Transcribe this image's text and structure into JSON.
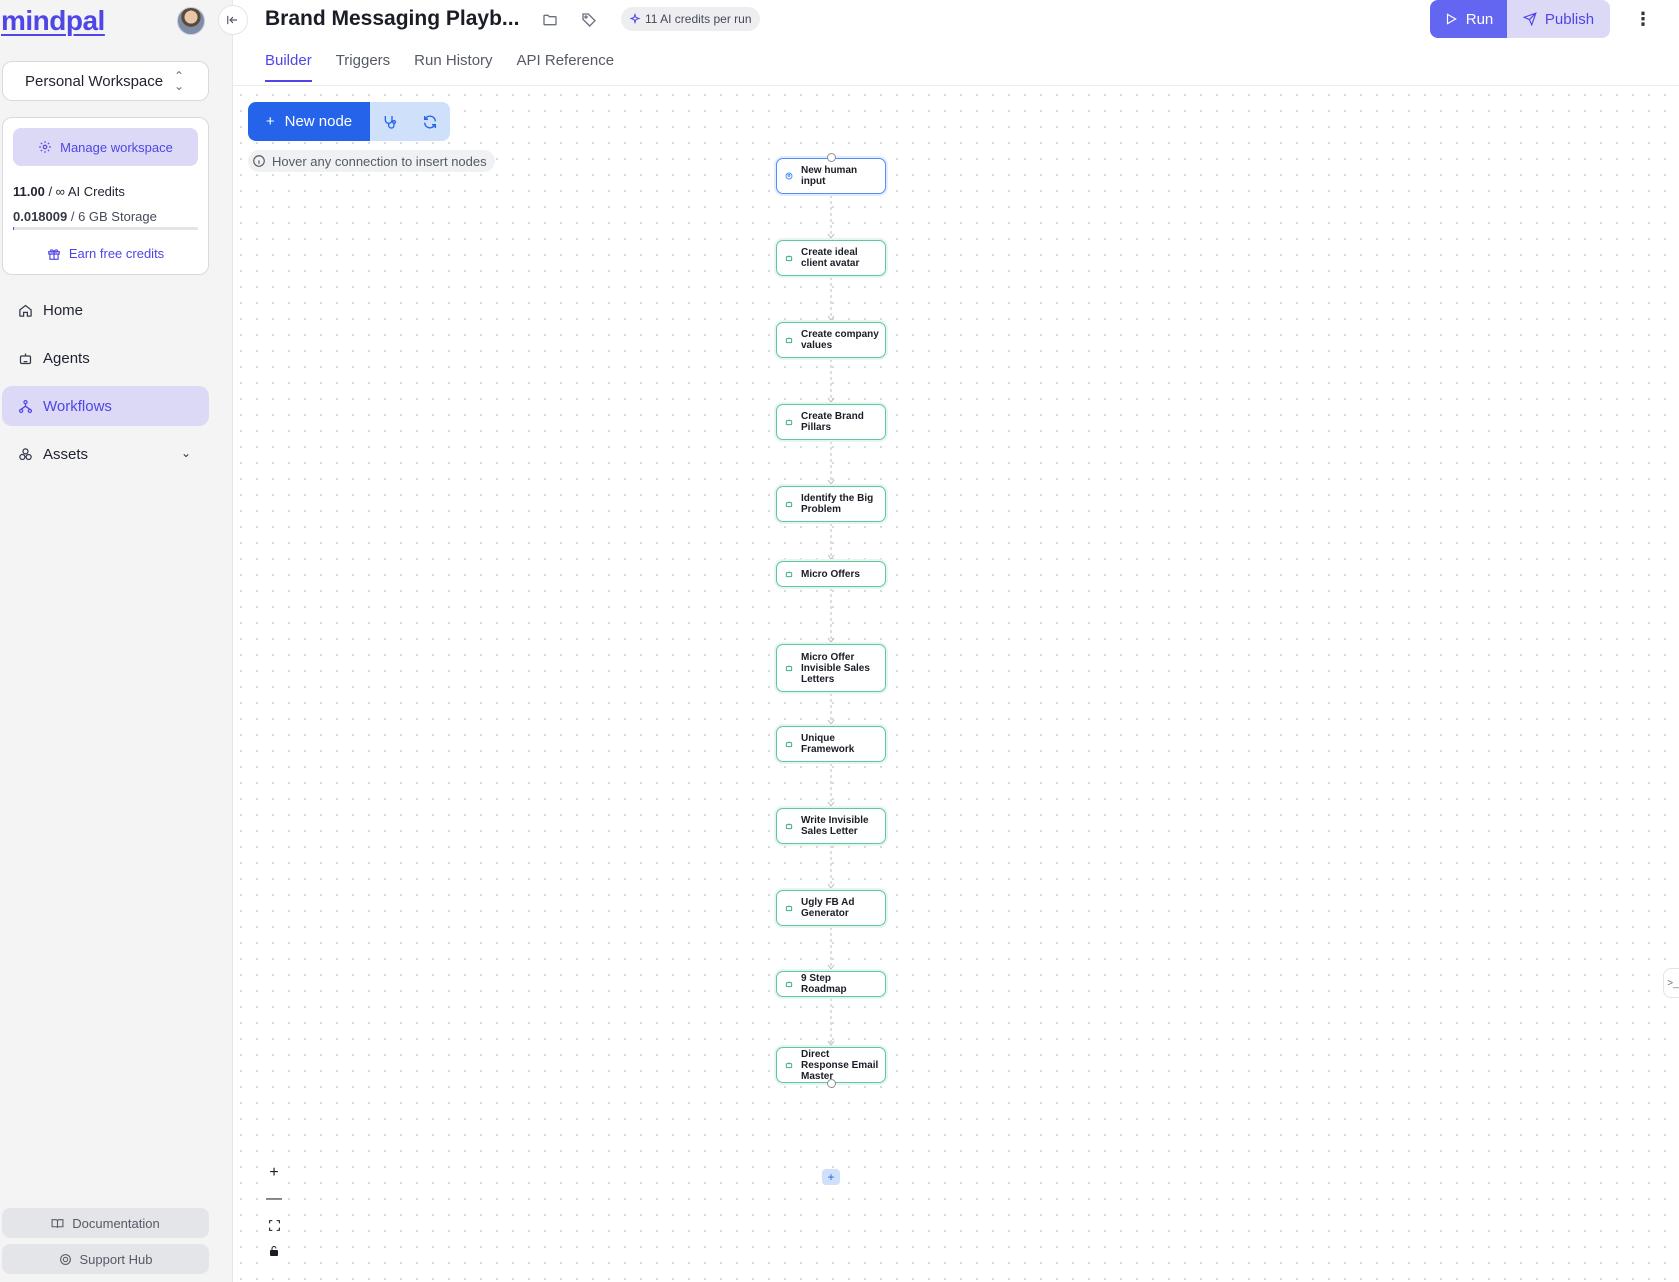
{
  "brand": {
    "logo_text": "mindpal",
    "accent": "#4f46e5"
  },
  "sidebar": {
    "workspace": "Personal Workspace",
    "manage_label": "Manage workspace",
    "credits_value": "11.00",
    "credits_suffix": " / ∞ AI Credits",
    "storage_value": "0.018009",
    "storage_suffix": " / 6 GB Storage",
    "storage_used_fraction": 0.003,
    "earn_label": "Earn free credits",
    "nav": [
      {
        "label": "Home",
        "icon": "home-icon"
      },
      {
        "label": "Agents",
        "icon": "robot-icon"
      },
      {
        "label": "Workflows",
        "icon": "workflow-icon",
        "active": true
      },
      {
        "label": "Assets",
        "icon": "assets-icon"
      }
    ],
    "documentation_label": "Documentation",
    "support_label": "Support Hub"
  },
  "header": {
    "title": "Brand Messaging Playb...",
    "credits_pill": "11 AI credits per run",
    "run_label": "Run",
    "publish_label": "Publish",
    "tabs": [
      "Builder",
      "Triggers",
      "Run History",
      "API Reference"
    ],
    "active_tab": "Builder"
  },
  "canvas": {
    "new_node_label": "New node",
    "hint": "Hover any connection to insert nodes",
    "nodes": [
      {
        "label": "New human input",
        "kind": "human"
      },
      {
        "label": "Create ideal client avatar",
        "kind": "agent"
      },
      {
        "label": "Create company values",
        "kind": "agent"
      },
      {
        "label": "Create Brand Pillars",
        "kind": "agent"
      },
      {
        "label": "Identify the Big Problem",
        "kind": "agent"
      },
      {
        "label": "Micro Offers",
        "kind": "agent"
      },
      {
        "label": "Micro Offer Invisible Sales Letters",
        "kind": "agent"
      },
      {
        "label": "Unique Framework",
        "kind": "agent"
      },
      {
        "label": "Write Invisible Sales Letter",
        "kind": "agent"
      },
      {
        "label": "Ugly FB Ad Generator",
        "kind": "agent"
      },
      {
        "label": "9 Step Roadmap",
        "kind": "agent"
      },
      {
        "label": "Direct Response Email Master",
        "kind": "agent"
      }
    ]
  }
}
